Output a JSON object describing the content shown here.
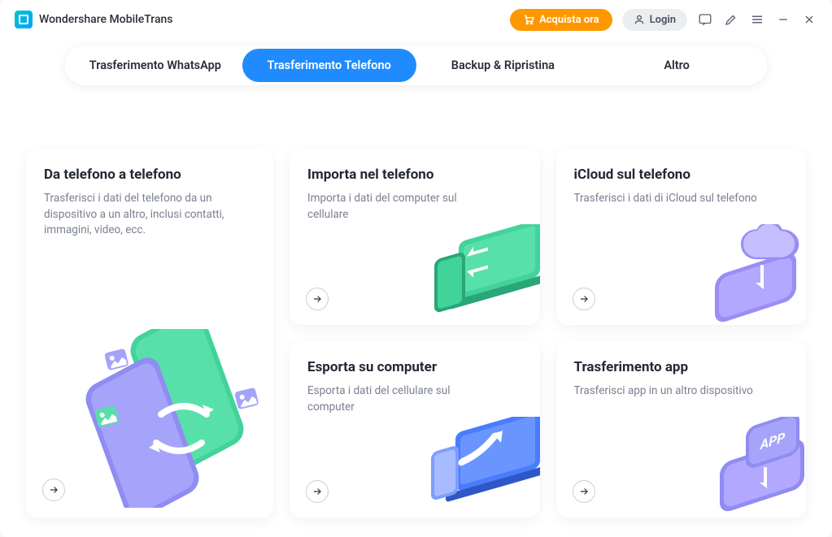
{
  "app": {
    "title": "Wondershare MobileTrans"
  },
  "header": {
    "buy": "Acquista ora",
    "login": "Login"
  },
  "tabs": [
    {
      "label": "Trasferimento WhatsApp",
      "active": false
    },
    {
      "label": "Trasferimento Telefono",
      "active": true
    },
    {
      "label": "Backup & Ripristina",
      "active": false
    },
    {
      "label": "Altro",
      "active": false
    }
  ],
  "cards": {
    "phone_to_phone": {
      "title": "Da telefono a telefono",
      "desc": "Trasferisci i dati del telefono da un dispositivo a un altro, inclusi contatti, immagini, video, ecc."
    },
    "import": {
      "title": "Importa nel telefono",
      "desc": "Importa i dati del computer sul cellulare"
    },
    "icloud": {
      "title": "iCloud sul telefono",
      "desc": "Trasferisci i dati di iCloud sul telefono"
    },
    "export": {
      "title": "Esporta su computer",
      "desc": "Esporta i dati del cellulare sul computer"
    },
    "apps": {
      "title": "Trasferimento app",
      "desc": "Trasferisci app in un altro dispositivo",
      "badge": "APP"
    }
  }
}
